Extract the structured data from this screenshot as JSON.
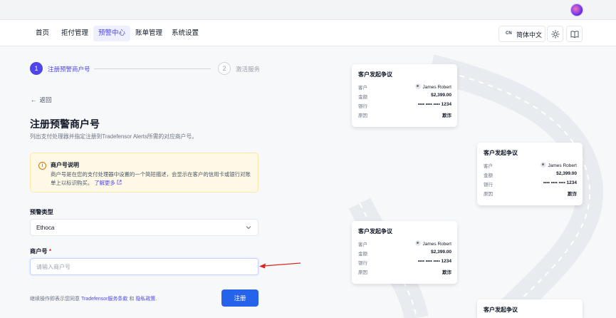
{
  "nav": {
    "items": [
      "首页",
      "拒付管理",
      "预警中心",
      "账单管理",
      "系统设置"
    ],
    "active_index": 2,
    "lang_code": "CN",
    "lang_label": "简体中文",
    "icons": [
      "sun-icon",
      "book-icon"
    ]
  },
  "steps": [
    {
      "number": "1",
      "label": "注册预警商户号",
      "state": "active"
    },
    {
      "number": "2",
      "label": "激活服务",
      "state": "pending"
    }
  ],
  "back_label": "返回",
  "page": {
    "title": "注册预警商户号",
    "subtitle": "列出支付处理器并指定注册到Tradefensor Alerts所需的对应商户号。"
  },
  "info": {
    "title": "商户号说明",
    "text": "商户号是在您的支付处理器中设置的一个简短描述，会显示在客户的信用卡或银行对账单上以标识购买。",
    "link": "了解更多"
  },
  "form": {
    "alert_type_label": "预警类型",
    "alert_type_value": "Ethoca",
    "merchant_label": "商户号",
    "required_mark": "*",
    "merchant_placeholder": "请输入商户号",
    "merchant_value": ""
  },
  "terms": {
    "prefix": "继续操作即表示您同意",
    "link1": "Tradefensor服务条款",
    "and": "和",
    "link2": "隐私政策",
    "suffix": "."
  },
  "submit_label": "注册",
  "dispute_cards": [
    {
      "title": "客户发起争议",
      "customer_label": "客户",
      "customer": "James Robert",
      "amount_label": "金额",
      "amount": "$2,399.00",
      "bank_label": "银行",
      "bank": "•••• •••• •••• 1234",
      "reason_label": "原因",
      "reason": "欺诈"
    },
    {
      "title": "客户发起争议",
      "customer_label": "客户",
      "customer": "James Robert",
      "amount_label": "金额",
      "amount": "$2,399.00",
      "bank_label": "银行",
      "bank": "•••• •••• •••• 1234",
      "reason_label": "原因",
      "reason": "欺诈"
    },
    {
      "title": "客户发起争议",
      "customer_label": "客户",
      "customer": "James Robert",
      "amount_label": "金额",
      "amount": "$2,399.00",
      "bank_label": "银行",
      "bank": "•••• •••• •••• 1234",
      "reason_label": "原因",
      "reason": "欺诈"
    },
    {
      "title": "客户发起争议"
    }
  ],
  "colors": {
    "accent": "#4f46e5",
    "button": "#2563eb",
    "annotation_arrow": "#dc2626"
  }
}
